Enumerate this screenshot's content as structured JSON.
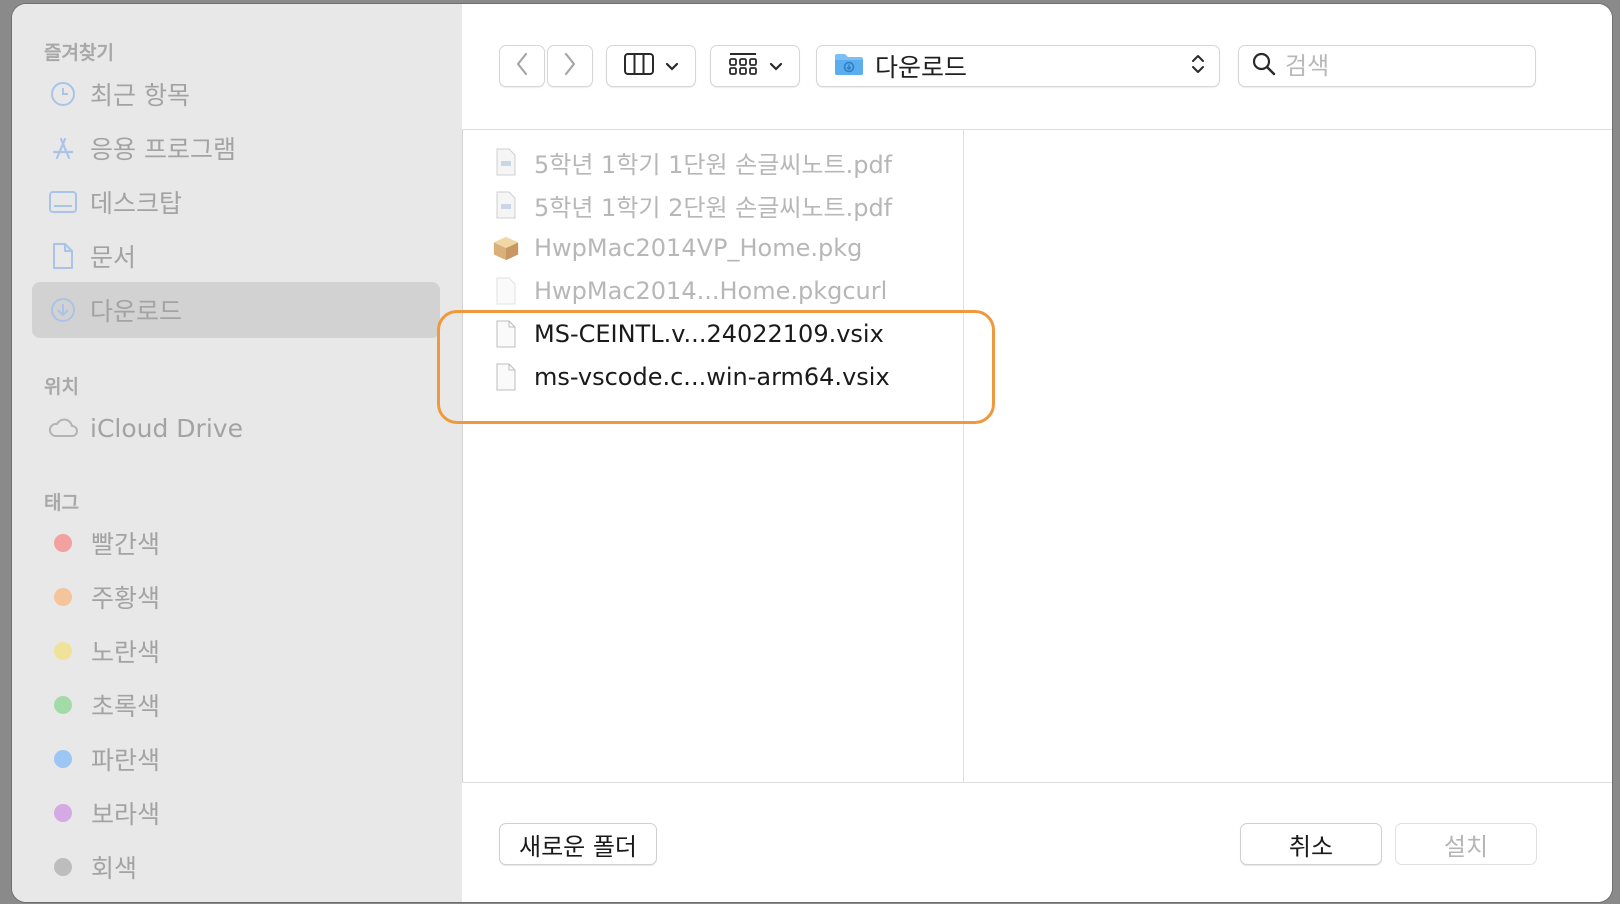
{
  "sidebar": {
    "favorites_heading": "즐겨찾기",
    "favorites": [
      {
        "label": "최근 항목",
        "icon": "clock-icon"
      },
      {
        "label": "응용 프로그램",
        "icon": "applications-icon"
      },
      {
        "label": "데스크탑",
        "icon": "desktop-icon"
      },
      {
        "label": "문서",
        "icon": "document-icon"
      },
      {
        "label": "다운로드",
        "icon": "download-icon",
        "selected": true
      }
    ],
    "locations_heading": "위치",
    "locations": [
      {
        "label": "iCloud Drive",
        "icon": "cloud-icon"
      }
    ],
    "tags_heading": "태그",
    "tags": [
      {
        "label": "빨간색",
        "color": "#f2a0a0"
      },
      {
        "label": "주황색",
        "color": "#f4c49a"
      },
      {
        "label": "노란색",
        "color": "#f1e29a"
      },
      {
        "label": "초록색",
        "color": "#a3dba8"
      },
      {
        "label": "파란색",
        "color": "#9cc6f4"
      },
      {
        "label": "보라색",
        "color": "#d5a8e6"
      },
      {
        "label": "회색",
        "color": "#bdbdbd"
      }
    ]
  },
  "toolbar": {
    "back_icon": "chevron-left-icon",
    "forward_icon": "chevron-right-icon",
    "view_columns_icon": "columns-view-icon",
    "group_icon": "grid-view-icon",
    "path_label": "다운로드",
    "search_placeholder": "검색"
  },
  "files": [
    {
      "name": "5학년 1학기 1단원 손글씨노트.pdf",
      "icon": "pdf-file-icon",
      "enabled": false
    },
    {
      "name": "5학년 1학기 2단원 손글씨노트.pdf",
      "icon": "pdf-file-icon",
      "enabled": false
    },
    {
      "name": "HwpMac2014VP_Home.pkg",
      "icon": "package-icon",
      "enabled": false
    },
    {
      "name": "HwpMac2014...Home.pkgcurl",
      "icon": "blank-file-icon",
      "enabled": false
    },
    {
      "name": "MS-CEINTL.v...24022109.vsix",
      "icon": "blank-file-icon",
      "enabled": true
    },
    {
      "name": "ms-vscode.c...win-arm64.vsix",
      "icon": "blank-file-icon",
      "enabled": true
    }
  ],
  "footer": {
    "new_folder_label": "새로운 폴더",
    "cancel_label": "취소",
    "install_label": "설치"
  },
  "colors": {
    "highlight": "#f0993c",
    "sidebar_bg": "#e8e8e8",
    "selected_bg": "#d2d2d2"
  }
}
